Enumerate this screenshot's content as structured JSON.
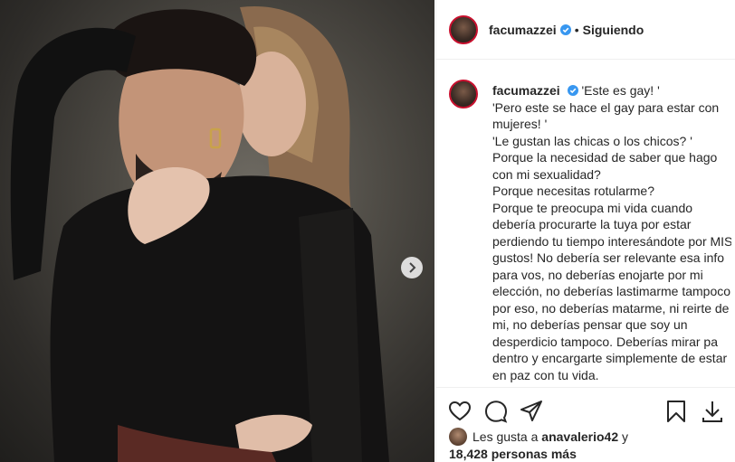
{
  "post": {
    "username": "facumazzei",
    "follow_status": "Siguiendo",
    "separator": "•",
    "caption_lines": [
      "'Este es gay! '",
      "'Pero este se hace el gay para estar con mujeres! '",
      "'Le gustan las chicas o los chicos? '",
      "Porque la necesidad de saber que hago con mi sexualidad?",
      "Porque necesitas rotularme?",
      "Porque te preocupa mi vida cuando debería procurarte la tuya por estar perdiendo tu tiempo interesándote por MIS gustos! No debería ser relevante esa info para vos, no deberías enojarte por mi elección, no deberías lastimarme tampoco por eso, no deberías matarme, ni reirte de mi, no deberías pensar que soy un desperdicio tampoco. Deberías mirar pa dentro y encargarte simplemente de estar en paz con tu vida."
    ]
  },
  "likes": {
    "prefix": "Les gusta a",
    "user": "anavalerio42",
    "connector": "y",
    "count_text": "18,428 personas más"
  },
  "icons": {
    "next": "chevron-right-icon",
    "like": "heart-icon",
    "comment": "comment-icon",
    "share": "share-icon",
    "save": "bookmark-icon",
    "download": "download-icon",
    "verified": "verified-badge-icon"
  },
  "colors": {
    "verified": "#3897f0",
    "border": "#efefef",
    "text": "#262626"
  }
}
